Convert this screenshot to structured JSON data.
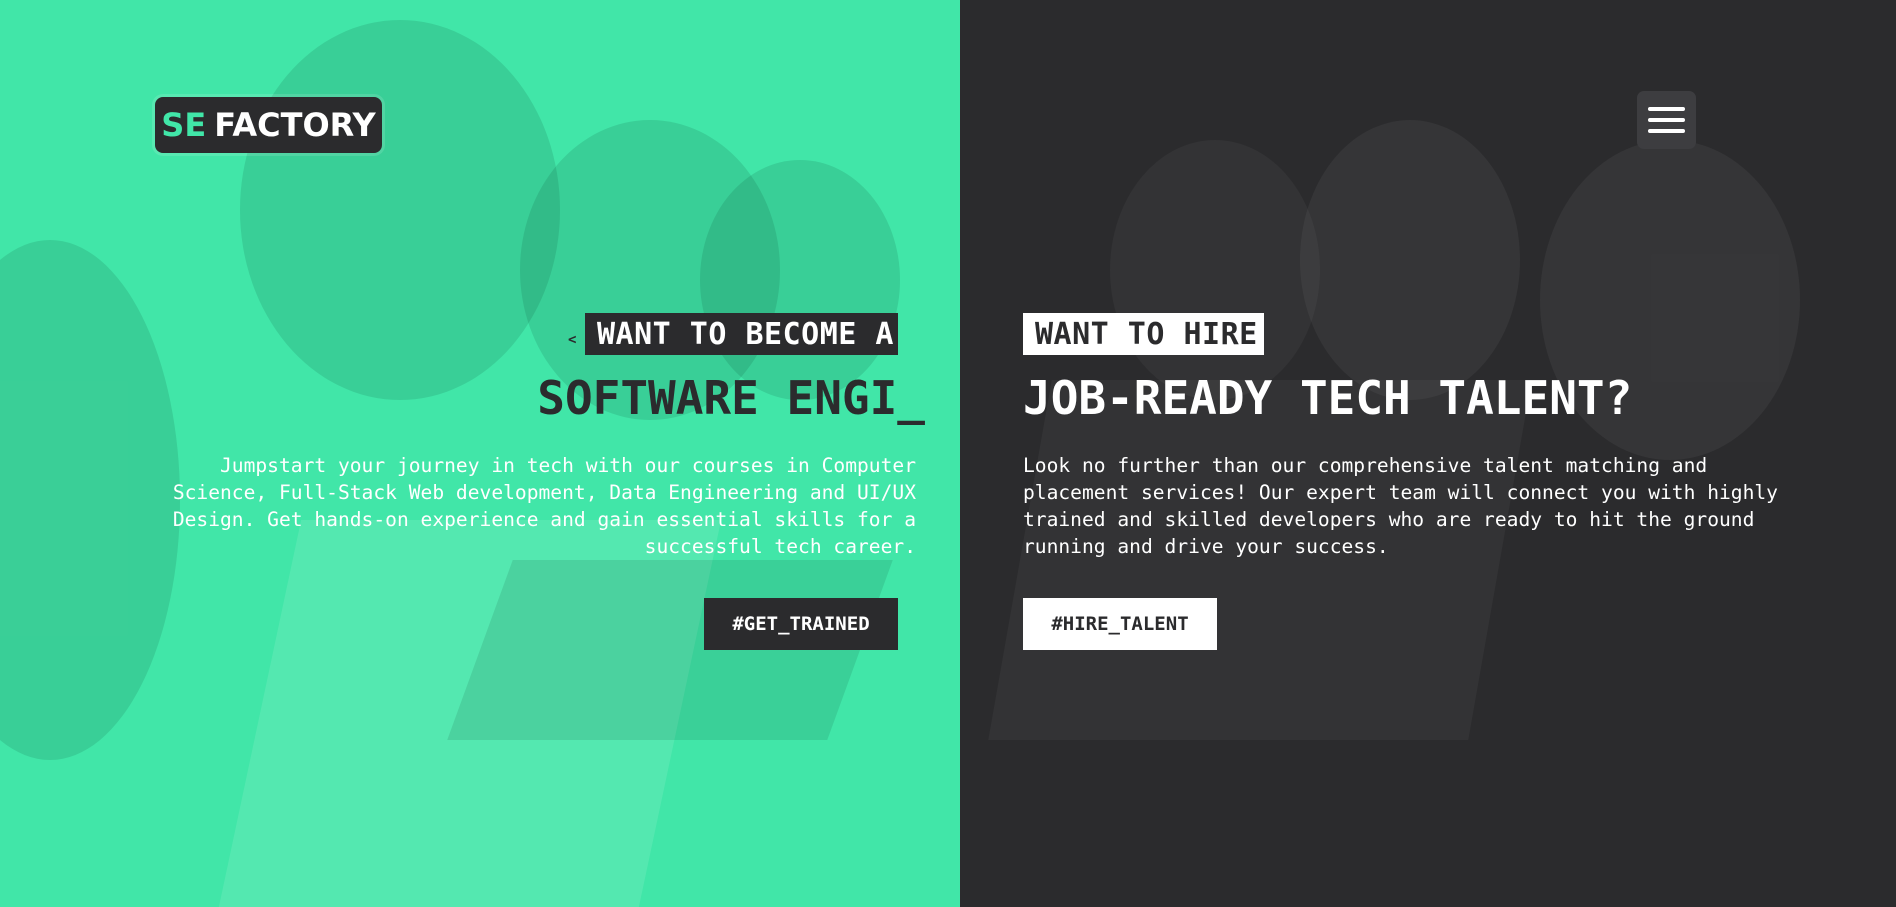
{
  "brand": {
    "logo_prefix": "SE",
    "logo_suffix": "FACTORY"
  },
  "colors": {
    "accent": "#41e6a8",
    "dark": "#2b2b2d",
    "light": "#ffffff"
  },
  "icons": {
    "menu": "hamburger-menu-icon",
    "caret": "caret-left-icon"
  },
  "learn": {
    "eyebrow": "WANT TO BECOME A",
    "headline": "SOFTWARE ENGI_",
    "description": "Jumpstart your journey in tech with our courses in Computer Science, Full-Stack Web development, Data Engineering and UI/UX Design. Get hands-on experience and gain essential skills for a successful tech career.",
    "cta_label": "#GET_TRAINED"
  },
  "hire": {
    "eyebrow": "WANT TO HIRE",
    "headline": "JOB-READY TECH TALENT?",
    "description": "Look no further than our comprehensive talent matching and placement services! Our expert team will connect you with highly trained and skilled developers who are ready to hit the ground running and drive your success.",
    "cta_label": "#HIRE_TALENT"
  }
}
